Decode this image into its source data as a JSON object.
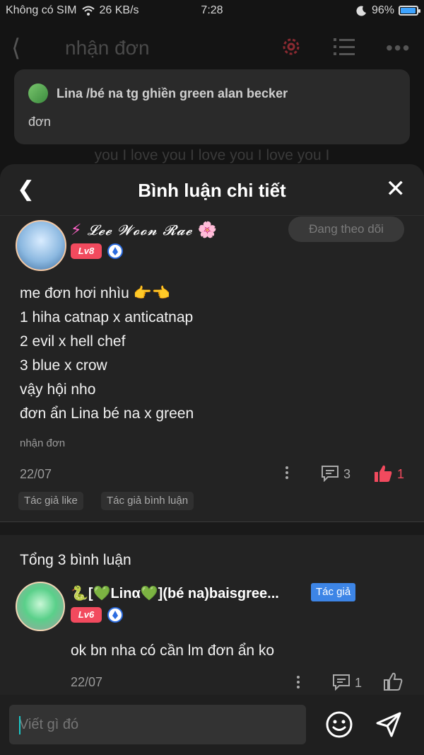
{
  "status": {
    "carrier": "Không có SIM",
    "speed": "26 KB/s",
    "time": "7:28",
    "battery": "96%",
    "battery_level": 0.96
  },
  "background": {
    "title": "nhận đơn",
    "card_name": "Lina /bé na tg ghiền green alan becker",
    "card_text": "đơn",
    "lyrics": "you I love you I love you I love you I"
  },
  "sheet": {
    "title": "Bình luận chi tiết",
    "post": {
      "username_prefix": "⚡",
      "username": "𝓛𝓮𝓮 𝓦𝓸𝓸𝓷 𝓡𝓪𝓮",
      "username_suffix": "🌸",
      "level": "Lv8",
      "follow_label": "Đang theo dõi",
      "lines": [
        "me đơn hơi nhìu 👉👈",
        "1 hiha catnap x anticatnap",
        "2 evil x hell chef",
        "3 blue x crow",
        "vậy hội nho",
        "đơn ẩn Lina bé na x green"
      ],
      "tag": "nhận đơn",
      "date": "22/07",
      "comment_count": "3",
      "like_count": "1",
      "chips": [
        "Tác giả like",
        "Tác giả bình luận"
      ]
    },
    "total_comments": "Tổng 3 bình luận",
    "comment": {
      "username": "🐍[💚Linα💚](bé na)baisgree...",
      "author_badge": "Tác giả",
      "level": "Lv6",
      "text": "ok bn nha có cần lm đơn ẩn ko",
      "date": "22/07",
      "reply_count": "1"
    },
    "input": {
      "placeholder": "Viết gì đó"
    }
  },
  "colors": {
    "accent_red": "#f24a5e",
    "accent_blue": "#3d85e6",
    "gear": "#e0424f",
    "sheet_bg": "#232323"
  }
}
